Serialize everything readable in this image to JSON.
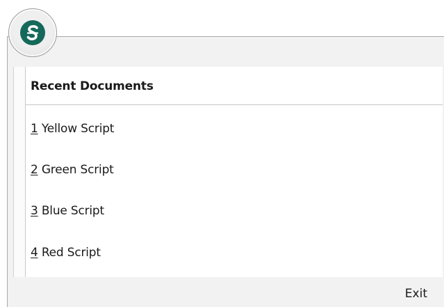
{
  "app": {
    "logo_icon": "app-s-logo-icon",
    "logo_color": "#15695a"
  },
  "recent": {
    "title": "Recent Documents",
    "items": [
      {
        "number": "1",
        "label": " Yellow Script"
      },
      {
        "number": "2",
        "label": " Green Script"
      },
      {
        "number": "3",
        "label": " Blue Script"
      },
      {
        "number": "4",
        "label": " Red Script"
      }
    ]
  },
  "footer": {
    "exit_label": "Exit"
  }
}
